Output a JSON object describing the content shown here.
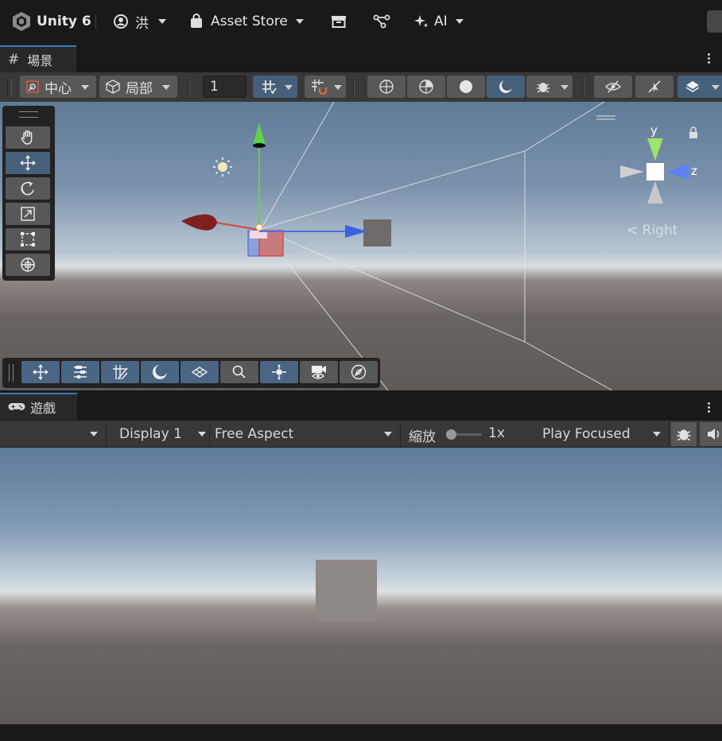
{
  "topbar": {
    "app_name": "Unity 6",
    "account_label": "洪",
    "asset_store_label": "Asset Store",
    "ai_label": "AI"
  },
  "scene_tab": {
    "label": "場景",
    "toolbar": {
      "pivot_label": "中心",
      "space_label": "局部",
      "grid_size_value": "1"
    },
    "gizmo": {
      "y_label": "y",
      "z_label": "z",
      "view_label": "< Right"
    }
  },
  "game_tab": {
    "label": "遊戲",
    "toolbar": {
      "display_label": "Display 1",
      "aspect_label": "Free Aspect",
      "scale_label": "縮放",
      "scale_value": "1x",
      "play_mode_label": "Play Focused"
    }
  },
  "colors": {
    "accent": "#3a79bb",
    "active_button": "#46607c",
    "panel_bg": "#383838",
    "window_bg": "#191919"
  }
}
